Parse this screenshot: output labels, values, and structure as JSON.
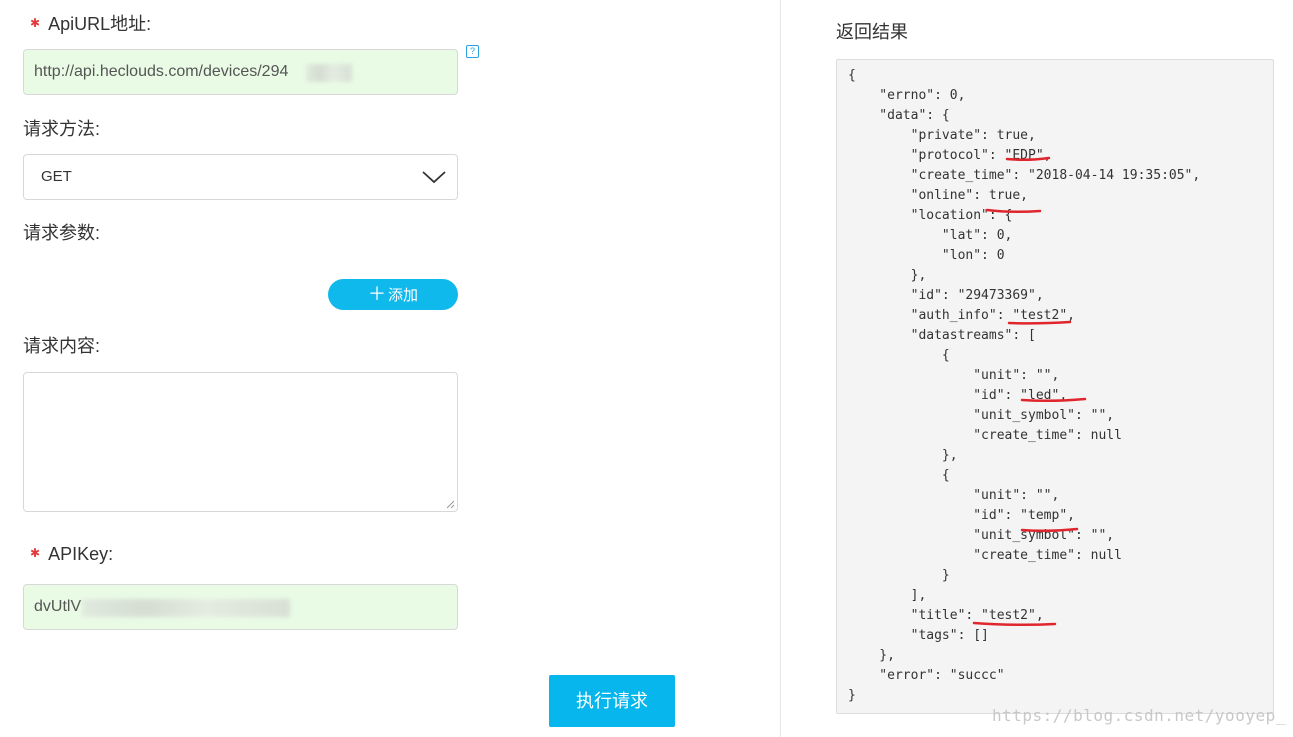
{
  "form": {
    "api_url_label": "ApiURL地址:",
    "api_url_value": "http://api.heclouds.com/devices/294",
    "help_icon": "?",
    "method_label": "请求方法:",
    "method_value": "GET",
    "params_label": "请求参数:",
    "add_button": "添加",
    "body_label": "请求内容:",
    "body_value": "",
    "apikey_label": "APIKey:",
    "apikey_value": "dvUtlV",
    "run_button": "执行请求"
  },
  "result": {
    "title": "返回结果",
    "json": "{\n    \"errno\": 0,\n    \"data\": {\n        \"private\": true,\n        \"protocol\": \"EDP\",\n        \"create_time\": \"2018-04-14 19:35:05\",\n        \"online\": true,\n        \"location\": {\n            \"lat\": 0,\n            \"lon\": 0\n        },\n        \"id\": \"29473369\",\n        \"auth_info\": \"test2\",\n        \"datastreams\": [\n            {\n                \"unit\": \"\",\n                \"id\": \"led\",\n                \"unit_symbol\": \"\",\n                \"create_time\": null\n            },\n            {\n                \"unit\": \"\",\n                \"id\": \"temp\",\n                \"unit_symbol\": \"\",\n                \"create_time\": null\n            }\n        ],\n        \"title\": \"test2\",\n        \"tags\": []\n    },\n    \"error\": \"succc\"\n}"
  },
  "watermark": "https://blog.csdn.net/yooyep_",
  "colors": {
    "accent": "#06b6ec",
    "input_bg": "#e9fbe5",
    "required": "#e4393c",
    "annotation": "#e0262d"
  }
}
